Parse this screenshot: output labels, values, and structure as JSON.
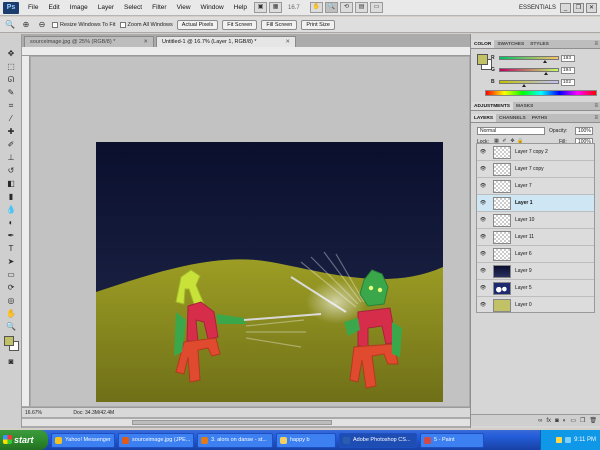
{
  "menubar": {
    "logo": "Ps",
    "items": [
      "File",
      "Edit",
      "Image",
      "Layer",
      "Select",
      "Filter",
      "View",
      "Window",
      "Help"
    ],
    "zoom": "16.7",
    "workspace": "ESSENTIALS"
  },
  "options": {
    "resize_windows": "Resize Windows To Fit",
    "zoom_all": "Zoom All Windows",
    "actual_pixels": "Actual Pixels",
    "fit_screen": "Fit Screen",
    "fill_screen": "Fill Screen",
    "print_size": "Print Size"
  },
  "documents": {
    "tabs": [
      {
        "label": "sourceimage.jpg @ 25% (RGB/8) *",
        "active": false
      },
      {
        "label": "Untitled-1 @ 16.7% (Layer 1, RGB/8) *",
        "active": true
      }
    ],
    "status_zoom": "16.67%",
    "status_doc": "Doc: 34.3M/42.4M"
  },
  "color_panel": {
    "tabs": [
      "COLOR",
      "SWATCHES",
      "STYLES"
    ],
    "r": "193",
    "g": "194",
    "b": "102",
    "foreground": "#c1c266",
    "r_value": 193,
    "g_value": 194,
    "b_value": 102
  },
  "adjust_tabs": [
    "ADJUSTMENTS",
    "MASKS"
  ],
  "layers_panel": {
    "tabs": [
      "LAYERS",
      "CHANNELS",
      "PATHS"
    ],
    "blend_mode": "Normal",
    "opacity_label": "Opacity:",
    "opacity": "100%",
    "lock_label": "Lock:",
    "fill_label": "Fill:",
    "fill": "100%",
    "layers": [
      {
        "name": "Layer 7 copy 2",
        "thumb": "checker",
        "selected": false
      },
      {
        "name": "Layer 7 copy",
        "thumb": "checker",
        "selected": false
      },
      {
        "name": "Layer 7",
        "thumb": "checker",
        "selected": false
      },
      {
        "name": "Layer 1",
        "thumb": "checker",
        "selected": true
      },
      {
        "name": "Layer 10",
        "thumb": "checker",
        "selected": false
      },
      {
        "name": "Layer 11",
        "thumb": "checker",
        "selected": false
      },
      {
        "name": "Layer 6",
        "thumb": "checker",
        "selected": false
      },
      {
        "name": "Layer 9",
        "thumb": "night",
        "selected": false
      },
      {
        "name": "Layer 5",
        "thumb": "clouds",
        "selected": false
      },
      {
        "name": "Layer 0",
        "thumb": "olive",
        "selected": false
      }
    ]
  },
  "taskbar": {
    "start": "start",
    "items": [
      {
        "label": "Yahoo! Messenger",
        "icon_color": "#f3c21b",
        "active": false
      },
      {
        "label": "sourceimage.jpg (JPE...",
        "icon_color": "#e05a1a",
        "active": false
      },
      {
        "label": "3. alors on danse - st...",
        "icon_color": "#e07a1a",
        "active": false
      },
      {
        "label": "happy b",
        "icon_color": "#f4d060",
        "active": false
      },
      {
        "label": "Adobe Photoshop CS...",
        "icon_color": "#2a5db0",
        "active": true
      },
      {
        "label": "5 - Paint",
        "icon_color": "#d04a4a",
        "active": false
      }
    ],
    "clock": "9:11 PM"
  },
  "colors": {
    "sky_top": "#0b1030",
    "sky_bottom": "#1b2244",
    "ground": "#8a8c1e",
    "figure_red": "#d8304a",
    "figure_green": "#3aa84a",
    "figure_lime": "#c9e33a"
  }
}
